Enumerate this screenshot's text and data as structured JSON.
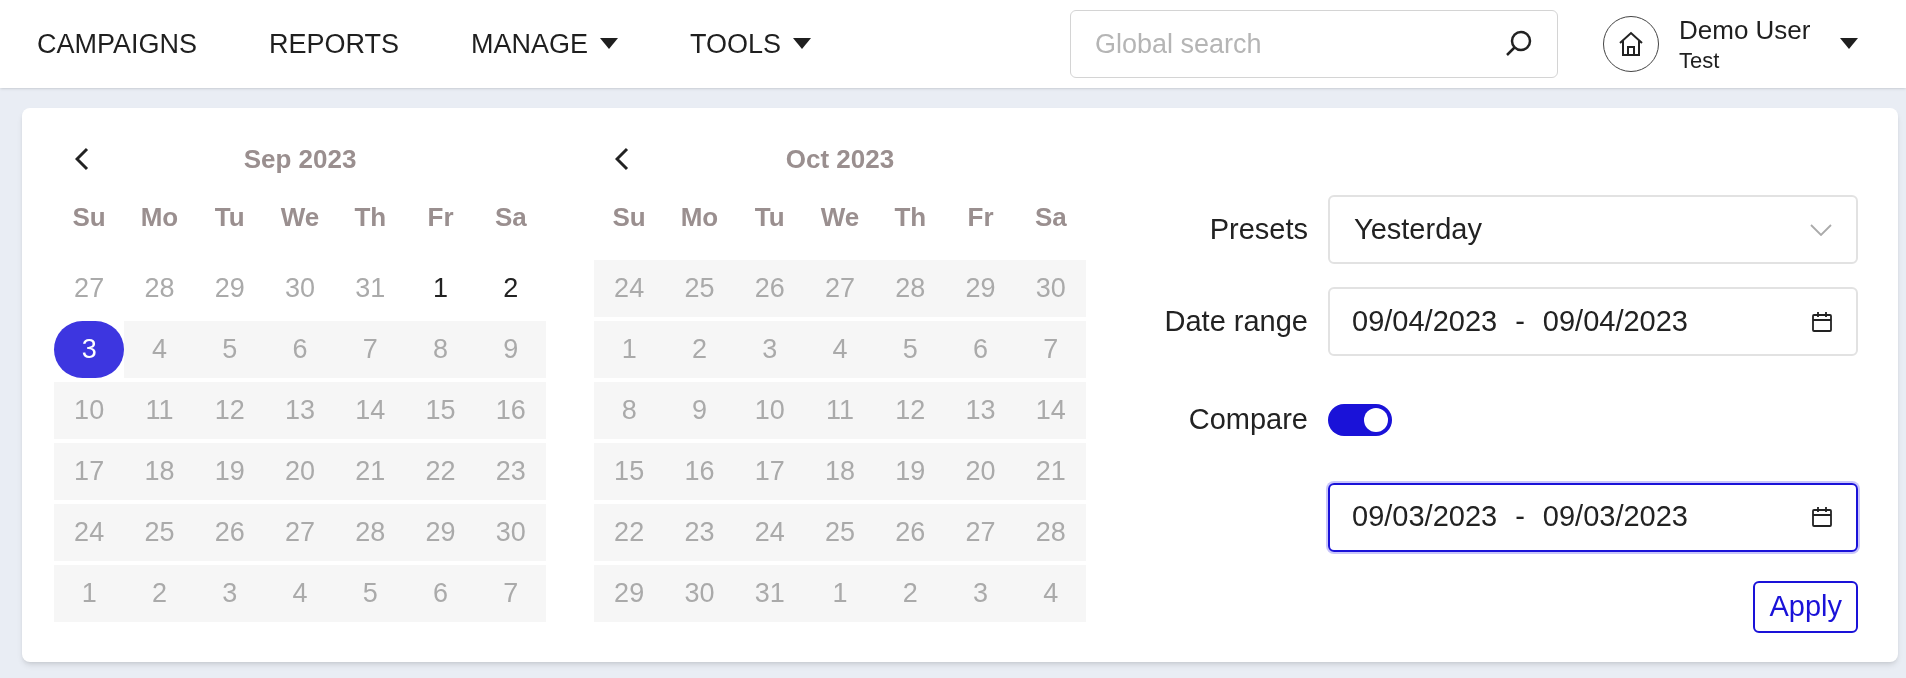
{
  "nav": {
    "items": [
      {
        "label": "CAMPAIGNS",
        "has_dropdown": false
      },
      {
        "label": "REPORTS",
        "has_dropdown": false
      },
      {
        "label": "MANAGE",
        "has_dropdown": true
      },
      {
        "label": "TOOLS",
        "has_dropdown": true
      }
    ],
    "search": {
      "placeholder": "Global search"
    },
    "user": {
      "name": "Demo User",
      "account": "Test"
    }
  },
  "calendars": [
    {
      "title": "Sep 2023",
      "weekdays": [
        "Su",
        "Mo",
        "Tu",
        "We",
        "Th",
        "Fr",
        "Sa"
      ],
      "weeks": [
        [
          {
            "label": "27",
            "kind": "outside",
            "selected": false
          },
          {
            "label": "28",
            "kind": "outside",
            "selected": false
          },
          {
            "label": "29",
            "kind": "outside",
            "selected": false
          },
          {
            "label": "30",
            "kind": "outside",
            "selected": false
          },
          {
            "label": "31",
            "kind": "outside",
            "selected": false
          },
          {
            "label": "1",
            "kind": "enabled",
            "selected": false
          },
          {
            "label": "2",
            "kind": "enabled",
            "selected": false
          }
        ],
        [
          {
            "label": "3",
            "kind": "enabled",
            "selected": true
          },
          {
            "label": "4",
            "kind": "disabled",
            "selected": false
          },
          {
            "label": "5",
            "kind": "disabled",
            "selected": false
          },
          {
            "label": "6",
            "kind": "disabled",
            "selected": false
          },
          {
            "label": "7",
            "kind": "disabled",
            "selected": false
          },
          {
            "label": "8",
            "kind": "disabled",
            "selected": false
          },
          {
            "label": "9",
            "kind": "disabled",
            "selected": false
          }
        ],
        [
          {
            "label": "10",
            "kind": "disabled",
            "selected": false
          },
          {
            "label": "11",
            "kind": "disabled",
            "selected": false
          },
          {
            "label": "12",
            "kind": "disabled",
            "selected": false
          },
          {
            "label": "13",
            "kind": "disabled",
            "selected": false
          },
          {
            "label": "14",
            "kind": "disabled",
            "selected": false
          },
          {
            "label": "15",
            "kind": "disabled",
            "selected": false
          },
          {
            "label": "16",
            "kind": "disabled",
            "selected": false
          }
        ],
        [
          {
            "label": "17",
            "kind": "disabled",
            "selected": false
          },
          {
            "label": "18",
            "kind": "disabled",
            "selected": false
          },
          {
            "label": "19",
            "kind": "disabled",
            "selected": false
          },
          {
            "label": "20",
            "kind": "disabled",
            "selected": false
          },
          {
            "label": "21",
            "kind": "disabled",
            "selected": false
          },
          {
            "label": "22",
            "kind": "disabled",
            "selected": false
          },
          {
            "label": "23",
            "kind": "disabled",
            "selected": false
          }
        ],
        [
          {
            "label": "24",
            "kind": "disabled",
            "selected": false
          },
          {
            "label": "25",
            "kind": "disabled",
            "selected": false
          },
          {
            "label": "26",
            "kind": "disabled",
            "selected": false
          },
          {
            "label": "27",
            "kind": "disabled",
            "selected": false
          },
          {
            "label": "28",
            "kind": "disabled",
            "selected": false
          },
          {
            "label": "29",
            "kind": "disabled",
            "selected": false
          },
          {
            "label": "30",
            "kind": "disabled",
            "selected": false
          }
        ],
        [
          {
            "label": "1",
            "kind": "disabled",
            "selected": false
          },
          {
            "label": "2",
            "kind": "disabled",
            "selected": false
          },
          {
            "label": "3",
            "kind": "disabled",
            "selected": false
          },
          {
            "label": "4",
            "kind": "disabled",
            "selected": false
          },
          {
            "label": "5",
            "kind": "disabled",
            "selected": false
          },
          {
            "label": "6",
            "kind": "disabled",
            "selected": false
          },
          {
            "label": "7",
            "kind": "disabled",
            "selected": false
          }
        ]
      ]
    },
    {
      "title": "Oct 2023",
      "weekdays": [
        "Su",
        "Mo",
        "Tu",
        "We",
        "Th",
        "Fr",
        "Sa"
      ],
      "weeks": [
        [
          {
            "label": "24",
            "kind": "disabled",
            "selected": false
          },
          {
            "label": "25",
            "kind": "disabled",
            "selected": false
          },
          {
            "label": "26",
            "kind": "disabled",
            "selected": false
          },
          {
            "label": "27",
            "kind": "disabled",
            "selected": false
          },
          {
            "label": "28",
            "kind": "disabled",
            "selected": false
          },
          {
            "label": "29",
            "kind": "disabled",
            "selected": false
          },
          {
            "label": "30",
            "kind": "disabled",
            "selected": false
          }
        ],
        [
          {
            "label": "1",
            "kind": "disabled",
            "selected": false
          },
          {
            "label": "2",
            "kind": "disabled",
            "selected": false
          },
          {
            "label": "3",
            "kind": "disabled",
            "selected": false
          },
          {
            "label": "4",
            "kind": "disabled",
            "selected": false
          },
          {
            "label": "5",
            "kind": "disabled",
            "selected": false
          },
          {
            "label": "6",
            "kind": "disabled",
            "selected": false
          },
          {
            "label": "7",
            "kind": "disabled",
            "selected": false
          }
        ],
        [
          {
            "label": "8",
            "kind": "disabled",
            "selected": false
          },
          {
            "label": "9",
            "kind": "disabled",
            "selected": false
          },
          {
            "label": "10",
            "kind": "disabled",
            "selected": false
          },
          {
            "label": "11",
            "kind": "disabled",
            "selected": false
          },
          {
            "label": "12",
            "kind": "disabled",
            "selected": false
          },
          {
            "label": "13",
            "kind": "disabled",
            "selected": false
          },
          {
            "label": "14",
            "kind": "disabled",
            "selected": false
          }
        ],
        [
          {
            "label": "15",
            "kind": "disabled",
            "selected": false
          },
          {
            "label": "16",
            "kind": "disabled",
            "selected": false
          },
          {
            "label": "17",
            "kind": "disabled",
            "selected": false
          },
          {
            "label": "18",
            "kind": "disabled",
            "selected": false
          },
          {
            "label": "19",
            "kind": "disabled",
            "selected": false
          },
          {
            "label": "20",
            "kind": "disabled",
            "selected": false
          },
          {
            "label": "21",
            "kind": "disabled",
            "selected": false
          }
        ],
        [
          {
            "label": "22",
            "kind": "disabled",
            "selected": false
          },
          {
            "label": "23",
            "kind": "disabled",
            "selected": false
          },
          {
            "label": "24",
            "kind": "disabled",
            "selected": false
          },
          {
            "label": "25",
            "kind": "disabled",
            "selected": false
          },
          {
            "label": "26",
            "kind": "disabled",
            "selected": false
          },
          {
            "label": "27",
            "kind": "disabled",
            "selected": false
          },
          {
            "label": "28",
            "kind": "disabled",
            "selected": false
          }
        ],
        [
          {
            "label": "29",
            "kind": "disabled",
            "selected": false
          },
          {
            "label": "30",
            "kind": "disabled",
            "selected": false
          },
          {
            "label": "31",
            "kind": "disabled",
            "selected": false
          },
          {
            "label": "1",
            "kind": "disabled",
            "selected": false
          },
          {
            "label": "2",
            "kind": "disabled",
            "selected": false
          },
          {
            "label": "3",
            "kind": "disabled",
            "selected": false
          },
          {
            "label": "4",
            "kind": "disabled",
            "selected": false
          }
        ]
      ]
    }
  ],
  "form": {
    "presets": {
      "label": "Presets",
      "value": "Yesterday"
    },
    "date_range": {
      "label": "Date range",
      "start": "09/04/2023",
      "separator": "-",
      "end": "09/04/2023"
    },
    "compare": {
      "label": "Compare",
      "on": true,
      "start": "09/03/2023",
      "separator": "-",
      "end": "09/03/2023",
      "focused": true
    },
    "apply_button": "Apply"
  }
}
